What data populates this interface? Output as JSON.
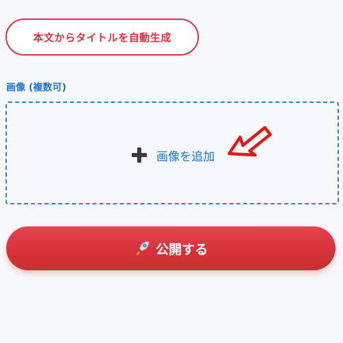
{
  "auto_title_button": {
    "label": "本文からタイトルを自動生成",
    "color": "#e0303b"
  },
  "images_section": {
    "label": "画像 (複数可)",
    "add_label": "画像を追加",
    "add_icon": "plus-icon",
    "annotation_icon": "pointer-arrow-icon",
    "accent_color": "#2b7fe0"
  },
  "publish_button": {
    "icon": "rocket-icon",
    "label": "公開する",
    "color": "#d63238"
  }
}
